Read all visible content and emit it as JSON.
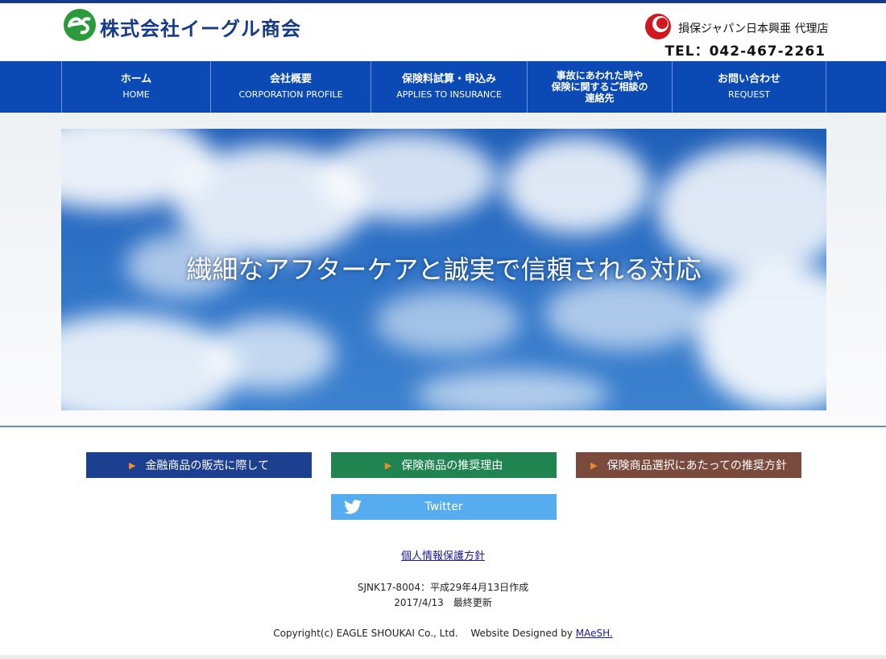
{
  "header": {
    "company_name": "株式会社イーグル商会",
    "partner_label": "損保ジャパン日本興亜 代理店",
    "tel": "TEL：042-467-2261",
    "logo_icon": "es-logo-icon",
    "partner_icon": "sompo-logo-icon"
  },
  "nav": {
    "items": [
      {
        "jp": "ホーム",
        "en": "HOME"
      },
      {
        "jp": "会社概要",
        "en": "CORPORATION PROFILE"
      },
      {
        "jp": "保険料試算・申込み",
        "en": "APPLIES TO INSURANCE"
      },
      {
        "lines": [
          "事故にあわれた時や",
          "保険に関するご相談の",
          "連絡先"
        ]
      },
      {
        "jp": "お問い合わせ",
        "en": "REQUEST"
      }
    ]
  },
  "hero": {
    "tagline": "繊細なアフターケアと誠実で信頼される対応"
  },
  "buttons": {
    "financial": "金融商品の販売に際して",
    "reason": "保険商品の推奨理由",
    "policy": "保険商品選択にあたっての推奨方針",
    "twitter": "Twitter",
    "arrow": "▶"
  },
  "footer": {
    "privacy_link": "個人情報保護方針",
    "doc_code": "SJNK17-8004：平成29年4月13日作成",
    "updated": "2017/4/13　最終更新",
    "copyright": "Copyright(c) EAGLE SHOUKAI Co., Ltd.　 Website Designed by ",
    "designer_link": "MAeSH."
  },
  "colors": {
    "nav_bg": "#0b49b4",
    "btn_blue": "#1d3f8f",
    "btn_green": "#1f8450",
    "btn_brown": "#7a4a3d",
    "twitter": "#55acee"
  }
}
